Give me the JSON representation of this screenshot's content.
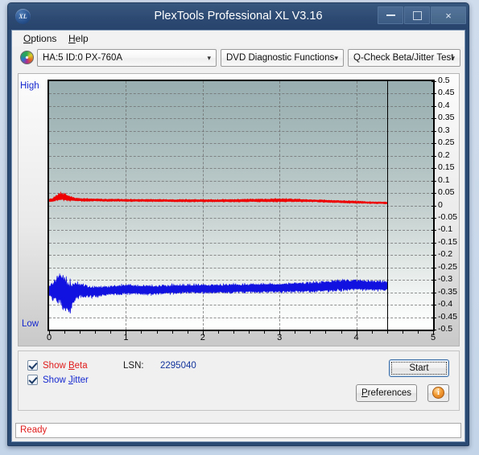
{
  "window": {
    "title": "PlexTools Professional XL V3.16",
    "app_icon": "xl-logo-icon",
    "minimize_label": "Minimize",
    "maximize_label": "Maximize",
    "close_label": "×"
  },
  "menubar": {
    "items": [
      {
        "label": "Options",
        "accel": "O"
      },
      {
        "label": "Help",
        "accel": "H"
      }
    ]
  },
  "toolbar": {
    "drive_combo": "HA:5 ID:0  PX-760A",
    "function_combo": "DVD Diagnostic Functions",
    "test_combo": "Q-Check Beta/Jitter Test",
    "caret": "⌄"
  },
  "controls": {
    "show_beta_label": "Show Beta",
    "show_beta_accel": "B",
    "show_beta_checked": true,
    "show_jitter_label": "Show Jitter",
    "show_jitter_accel": "J",
    "show_jitter_checked": true,
    "lsn_label": "LSN:",
    "lsn_value": "2295040",
    "start_label": "Start",
    "start_accel": "t",
    "preferences_label": "Preferences",
    "preferences_accel": "P",
    "info_label": "i"
  },
  "statusbar": {
    "text": "Ready"
  },
  "chart_data": {
    "type": "line",
    "title": "Q-Check Beta/Jitter Test",
    "xlabel": "",
    "ylabel": "",
    "xlim": [
      0,
      5
    ],
    "ylim": [
      -0.5,
      0.5
    ],
    "grid": true,
    "legend_position": "bottom-left",
    "y_axis_left_high_label": "High",
    "y_axis_left_low_label": "Low",
    "xticks": [
      0,
      1,
      2,
      3,
      4,
      5
    ],
    "xticklabels": [
      "0",
      "1",
      "2",
      "3",
      "4",
      "5"
    ],
    "yticks": [
      0.5,
      0.45,
      0.4,
      0.35,
      0.3,
      0.25,
      0.2,
      0.15,
      0.1,
      0.05,
      0,
      -0.05,
      -0.1,
      -0.15,
      -0.2,
      -0.25,
      -0.3,
      -0.35,
      -0.4,
      -0.45,
      -0.5
    ],
    "yticklabels": [
      "0.5",
      "0.45",
      "0.4",
      "0.35",
      "0.3",
      "0.25",
      "0.2",
      "0.15",
      "0.1",
      "0.05",
      "0",
      "-0.05",
      "-0.1",
      "-0.15",
      "-0.2",
      "-0.25",
      "-0.3",
      "-0.35",
      "-0.4",
      "-0.45",
      "-0.5"
    ],
    "data_end_marker_x": 4.4,
    "colors": {
      "beta": "#ee0000",
      "jitter": "#1212e0"
    },
    "series": [
      {
        "name": "Beta",
        "color": "#ee0000",
        "x": [
          0.0,
          0.05,
          0.1,
          0.15,
          0.2,
          0.25,
          0.3,
          0.35,
          0.4,
          0.5,
          0.6,
          0.7,
          0.8,
          0.9,
          1.0,
          1.2,
          1.4,
          1.6,
          1.8,
          2.0,
          2.2,
          2.4,
          2.6,
          2.8,
          3.0,
          3.2,
          3.4,
          3.6,
          3.8,
          4.0,
          4.2,
          4.4
        ],
        "values": [
          0.02,
          0.022,
          0.03,
          0.036,
          0.034,
          0.03,
          0.026,
          0.024,
          0.023,
          0.022,
          0.022,
          0.021,
          0.021,
          0.021,
          0.02,
          0.02,
          0.02,
          0.019,
          0.019,
          0.019,
          0.019,
          0.019,
          0.02,
          0.02,
          0.021,
          0.02,
          0.019,
          0.017,
          0.015,
          0.013,
          0.011,
          0.01
        ],
        "band": [
          0.006,
          0.008,
          0.013,
          0.016,
          0.014,
          0.011,
          0.009,
          0.007,
          0.006,
          0.006,
          0.005,
          0.005,
          0.005,
          0.005,
          0.005,
          0.005,
          0.005,
          0.005,
          0.005,
          0.005,
          0.005,
          0.006,
          0.006,
          0.006,
          0.007,
          0.006,
          0.005,
          0.005,
          0.005,
          0.005,
          0.004,
          0.004
        ]
      },
      {
        "name": "Jitter",
        "color": "#1212e0",
        "x": [
          0.0,
          0.05,
          0.1,
          0.15,
          0.2,
          0.25,
          0.3,
          0.35,
          0.4,
          0.5,
          0.6,
          0.7,
          0.8,
          0.9,
          1.0,
          1.2,
          1.4,
          1.6,
          1.8,
          2.0,
          2.2,
          2.4,
          2.6,
          2.8,
          3.0,
          3.2,
          3.4,
          3.6,
          3.8,
          4.0,
          4.2,
          4.4
        ],
        "values": [
          -0.34,
          -0.345,
          -0.34,
          -0.335,
          -0.355,
          -0.37,
          -0.36,
          -0.345,
          -0.34,
          -0.345,
          -0.348,
          -0.345,
          -0.342,
          -0.34,
          -0.338,
          -0.34,
          -0.34,
          -0.338,
          -0.336,
          -0.336,
          -0.336,
          -0.334,
          -0.334,
          -0.333,
          -0.332,
          -0.33,
          -0.33,
          -0.326,
          -0.322,
          -0.32,
          -0.322,
          -0.325
        ],
        "band": [
          0.022,
          0.035,
          0.055,
          0.07,
          0.078,
          0.07,
          0.055,
          0.04,
          0.03,
          0.024,
          0.022,
          0.02,
          0.02,
          0.02,
          0.019,
          0.019,
          0.019,
          0.018,
          0.018,
          0.018,
          0.018,
          0.018,
          0.018,
          0.019,
          0.019,
          0.02,
          0.021,
          0.022,
          0.023,
          0.022,
          0.021,
          0.02
        ]
      }
    ]
  }
}
